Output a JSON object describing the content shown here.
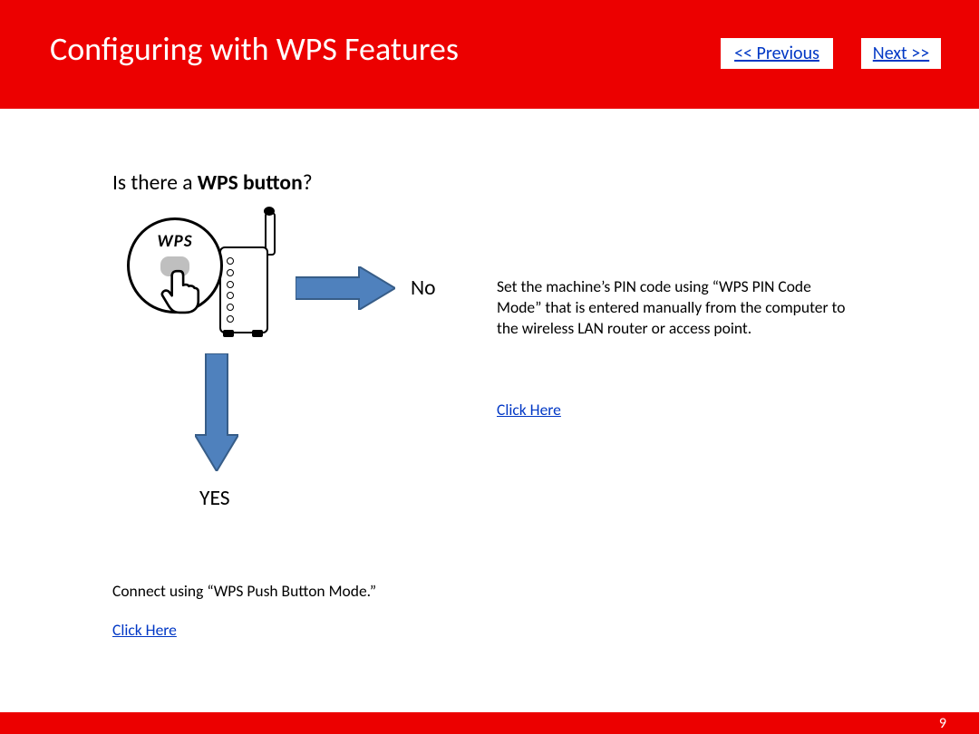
{
  "header": {
    "title": "Configuring with WPS Features",
    "prev_label": "<< Previous",
    "next_label": "Next >>"
  },
  "question": {
    "prefix": "Is there a ",
    "bold": "WPS button",
    "suffix": "?"
  },
  "illustration": {
    "bubble_text": "WPS"
  },
  "branches": {
    "no_label": "No",
    "yes_label": "YES",
    "no_desc": "Set the machine’s PIN code using “WPS PIN Code Mode” that is entered manually from the computer to the wireless LAN router or access point.",
    "no_link": "Click Here",
    "yes_desc": "Connect using “WPS Push Button Mode.”",
    "yes_link": "Click Here"
  },
  "footer": {
    "page_number": "9"
  }
}
